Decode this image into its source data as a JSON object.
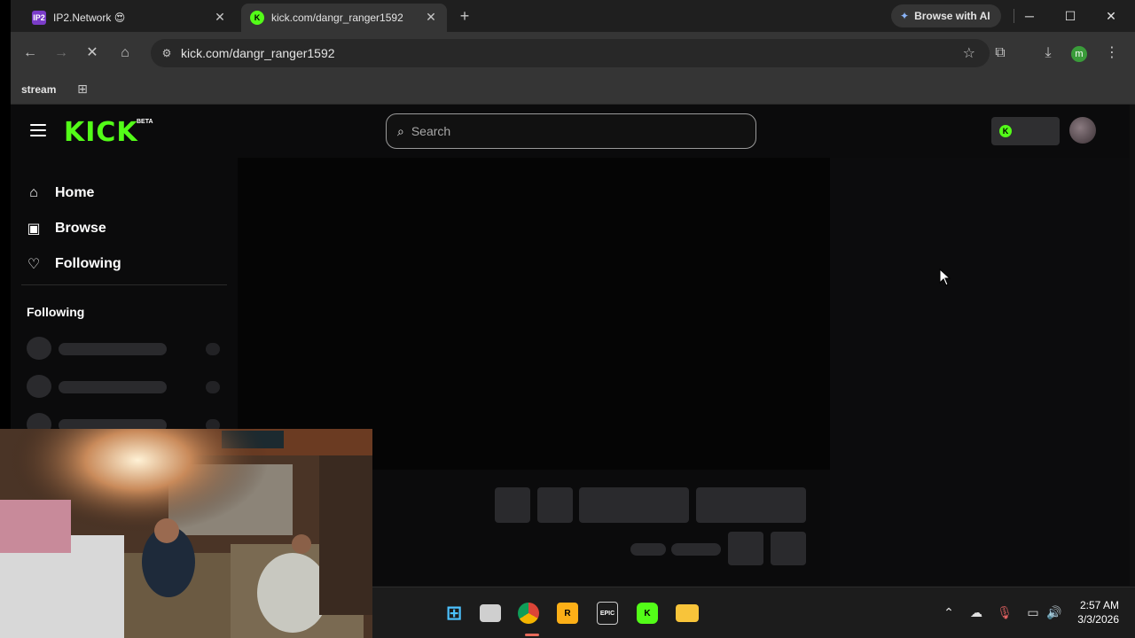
{
  "browser": {
    "tabs": [
      {
        "title": "IP2.Network 😍",
        "favicon": "IP2"
      },
      {
        "title": "kick.com/dangr_ranger1592",
        "favicon": "K"
      }
    ],
    "browse_ai_label": "Browse with AI",
    "url": "kick.com/dangr_ranger1592",
    "profile_initial": "m",
    "bookmarks": [
      {
        "label": "stream"
      }
    ]
  },
  "kick": {
    "logo": "KICK",
    "beta": "BETA",
    "search_placeholder": "Search",
    "nav": [
      {
        "label": "Home",
        "icon": "home-icon"
      },
      {
        "label": "Browse",
        "icon": "browse-icon"
      },
      {
        "label": "Following",
        "icon": "heart-icon"
      }
    ],
    "following_heading": "Following",
    "accent_color": "#53fc18"
  },
  "taskbar": {
    "apps": [
      "start-icon",
      "task-view-icon",
      "chrome-icon",
      "rockstar-icon",
      "epic-games-icon",
      "kick-app-icon",
      "file-explorer-icon"
    ],
    "time": "2:57 AM",
    "date": "3/3/2026"
  }
}
